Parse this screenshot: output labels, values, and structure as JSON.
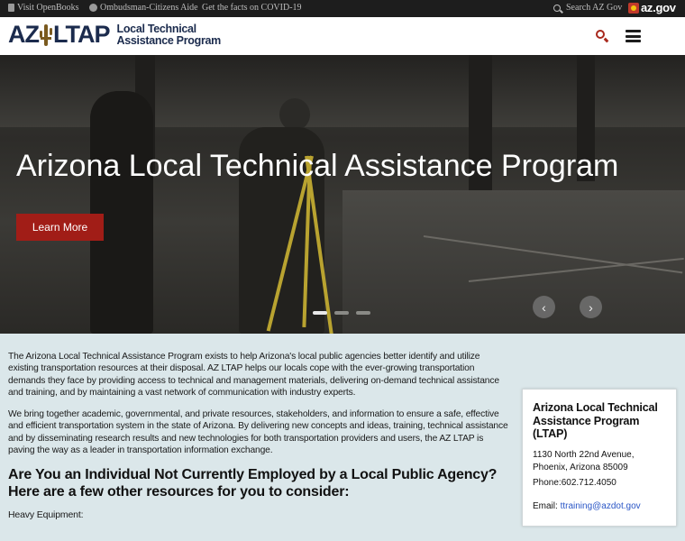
{
  "topbar": {
    "openbooks": "Visit OpenBooks",
    "ombudsman": "Ombudsman-Citizens Aide",
    "covid": "Get the facts on COVID-19",
    "search": "Search AZ Gov",
    "azgov": "az.gov"
  },
  "header": {
    "logo_az": "AZ",
    "logo_ltap": "LTAP",
    "logo_line1": "Local Technical",
    "logo_line2": "Assistance Program"
  },
  "hero": {
    "title": "Arizona Local Technical Assistance Program",
    "button": "Learn More",
    "prev": "‹",
    "next": "›",
    "slides": 3,
    "active_slide": 1
  },
  "main": {
    "para1": "The Arizona Local Technical Assistance Program exists to help Arizona's local public agencies better identify and utilize existing transportation resources at their disposal. AZ LTAP helps our locals cope with the ever-growing transportation demands they face by providing access to technical and management materials, delivering on-demand technical assistance and training, and by maintaining a vast network of communication with industry experts.",
    "para2": "We bring together academic, governmental, and private resources, stakeholders, and information to ensure a safe, effective and efficient transportation system in the state of Arizona. By delivering new concepts and ideas, training, technical assistance and by disseminating research results and new technologies for both transportation providers and users, the AZ LTAP is paving the way as a leader in transportation information exchange.",
    "heading": "Are You an Individual Not Currently Employed by a Local Public Agency? Here are a few other resources for you to consider:",
    "sub": "Heavy Equipment:"
  },
  "contact": {
    "title": "Arizona Local Technical Assistance Program (LTAP)",
    "address": "1130 North 22nd Avenue, Phoenix, Arizona 85009",
    "phone": "Phone:602.712.4050",
    "email_label": "Email:",
    "email": "ttraining@azdot.gov"
  },
  "colors": {
    "accent": "#a11d17",
    "navy": "#1b2b4d",
    "background": "#dbe7ea"
  }
}
